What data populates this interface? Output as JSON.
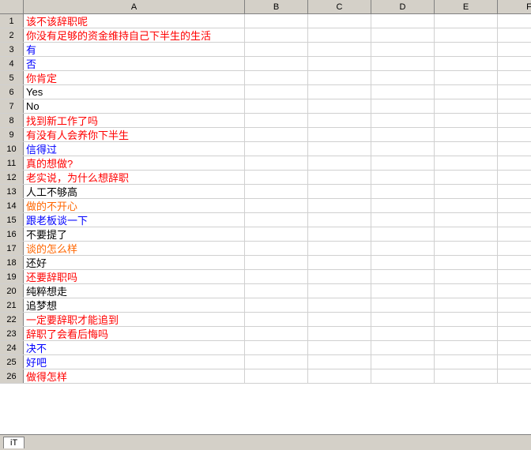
{
  "columns": [
    "A",
    "B",
    "C",
    "D",
    "E",
    "F"
  ],
  "rows": [
    {
      "num": 1,
      "text": "该不该辞职呢",
      "color": "red"
    },
    {
      "num": 2,
      "text": "你没有足够的资金维持自己下半生的生活",
      "color": "red"
    },
    {
      "num": 3,
      "text": "有",
      "color": "blue"
    },
    {
      "num": 4,
      "text": "否",
      "color": "blue"
    },
    {
      "num": 5,
      "text": "你肯定",
      "color": "red"
    },
    {
      "num": 6,
      "text": "Yes",
      "color": "black"
    },
    {
      "num": 7,
      "text": "No",
      "color": "black"
    },
    {
      "num": 8,
      "text": "找到新工作了吗",
      "color": "red"
    },
    {
      "num": 9,
      "text": "有没有人会养你下半生",
      "color": "red"
    },
    {
      "num": 10,
      "text": "信得过",
      "color": "blue"
    },
    {
      "num": 11,
      "text": "真的想做?",
      "color": "red"
    },
    {
      "num": 12,
      "text": "老实说，为什么想辞职",
      "color": "red"
    },
    {
      "num": 13,
      "text": "人工不够高",
      "color": "black"
    },
    {
      "num": 14,
      "text": "做的不开心",
      "color": "orange"
    },
    {
      "num": 15,
      "text": "跟老板谈一下",
      "color": "blue"
    },
    {
      "num": 16,
      "text": "不要提了",
      "color": "black"
    },
    {
      "num": 17,
      "text": "谈的怎么样",
      "color": "orange"
    },
    {
      "num": 18,
      "text": "还好",
      "color": "black"
    },
    {
      "num": 19,
      "text": "还要辞职吗",
      "color": "red"
    },
    {
      "num": 20,
      "text": "纯粹想走",
      "color": "black"
    },
    {
      "num": 21,
      "text": "追梦想",
      "color": "black"
    },
    {
      "num": 22,
      "text": "一定要辞职才能追到",
      "color": "red"
    },
    {
      "num": 23,
      "text": "辞职了会看后悔吗",
      "color": "red"
    },
    {
      "num": 24,
      "text": "决不",
      "color": "blue"
    },
    {
      "num": 25,
      "text": "好吧",
      "color": "blue"
    },
    {
      "num": 26,
      "text": "做得怎样",
      "color": "red"
    }
  ],
  "bottom": {
    "tab_label": "iT",
    "status": ""
  }
}
